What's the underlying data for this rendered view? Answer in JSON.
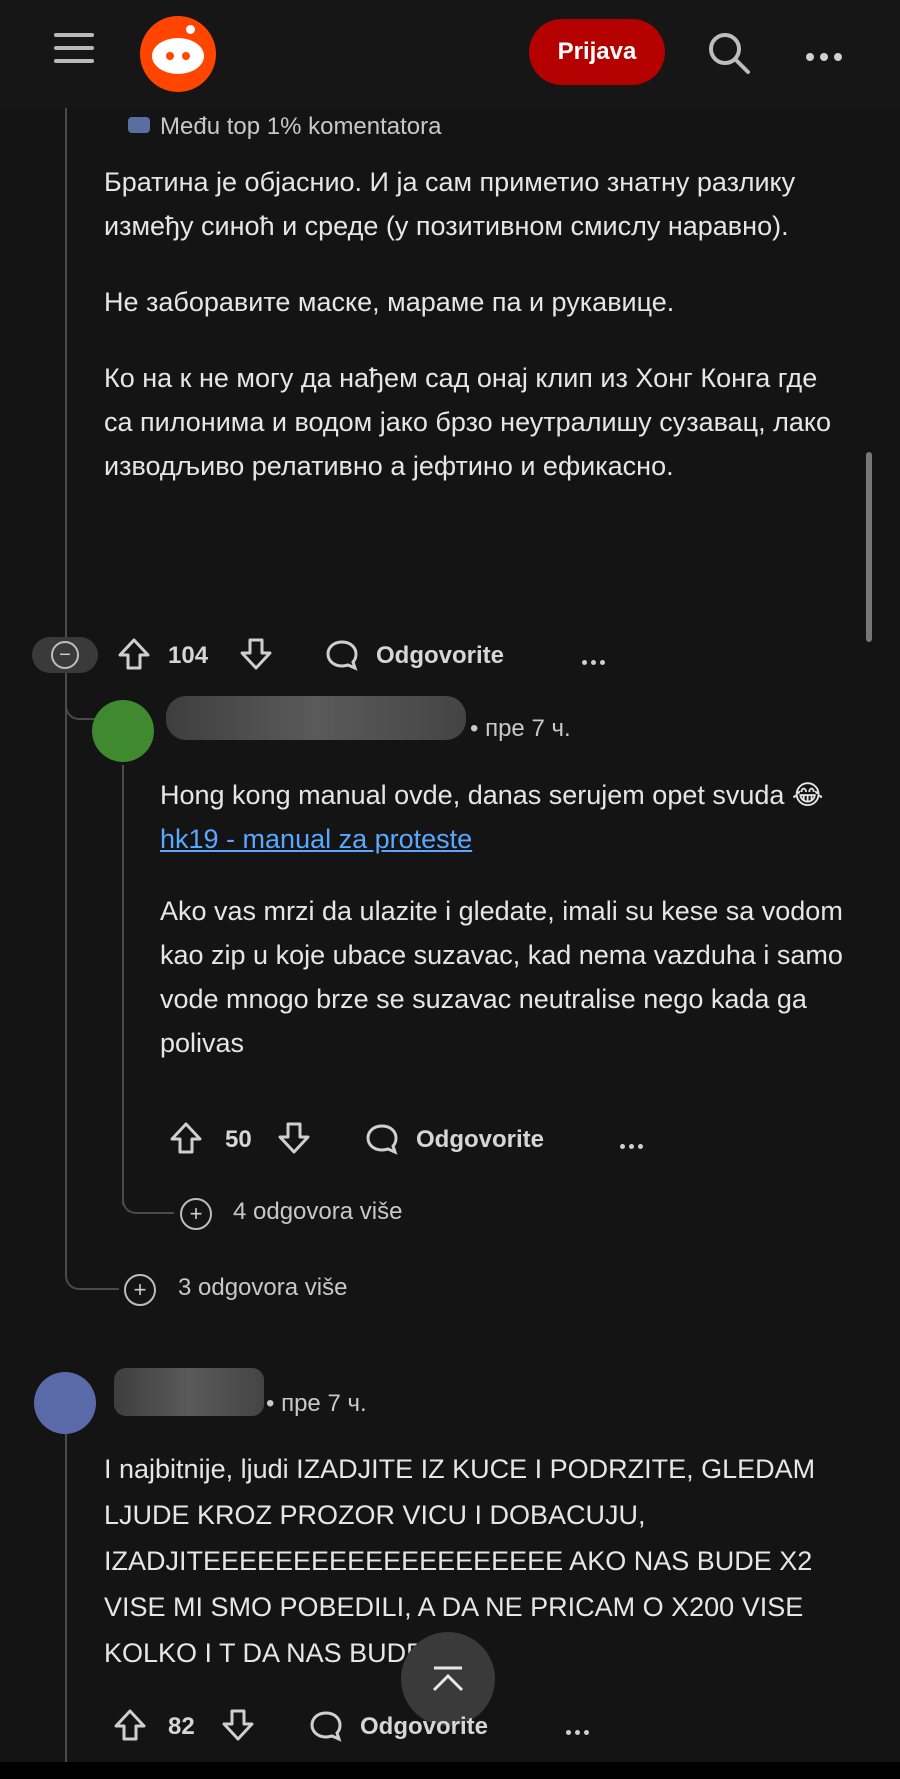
{
  "header": {
    "login_label": "Prijava",
    "menu_icon": "hamburger-icon",
    "logo_icon": "reddit-logo",
    "search_icon": "search-icon",
    "more_icon": "more-horizontal-icon"
  },
  "comment1": {
    "badge": "Među top 1% komentatora",
    "paragraphs": [
      "Братина је објаснио. И ја сам приметио знатну разлику између синоћ и среде (у позитивном смислу наравно).",
      "Не заборавите маске, мараме па и рукавице.",
      "Ко на к не могу да нађем сад онај клип из Хонг Конга где са пилонима и водом јако брзо неутралишу сузавац, лако изводљиво релативно а јефтино и ефикасно."
    ],
    "votes": "104",
    "reply_label": "Odgovorite"
  },
  "comment2": {
    "time": "пре 7 ч.",
    "text_prefix": "Hong kong manual ovde, danas serujem opet svuda ",
    "emoji": "😂",
    "link_text": "hk19 - manual za proteste",
    "paragraph2": "Ako vas mrzi da ulazite i gledate, imali su kese sa vodom kao zip u koje ubace suzavac, kad nema vazduha i samo vode mnogo brze se suzavac neutralise nego kada ga polivas",
    "votes": "50",
    "reply_label": "Odgovorite",
    "more_replies": "4 odgovora više"
  },
  "thread_more_replies": "3 odgovora više",
  "comment3": {
    "time": "пре 7 ч.",
    "text": "I najbitnije, ljudi IZADJITE IZ KUCE I PODRZITE, GLEDAM LJUDE KROZ PROZOR VICU I DOBACUJU, IZADJITEEEEEEEEEEEEEEEEEEEE AKO NAS BUDE X2 VISE MI SMO POBEDILI, A DA NE PRICAM O X200 VISE KOLKO I T DA NAS BUDE!",
    "votes": "82",
    "reply_label": "Odgovorite"
  },
  "colors": {
    "background": "#141414",
    "login_button": "#b50000",
    "reddit_orange": "#ff4500",
    "link": "#5aa7ff"
  }
}
